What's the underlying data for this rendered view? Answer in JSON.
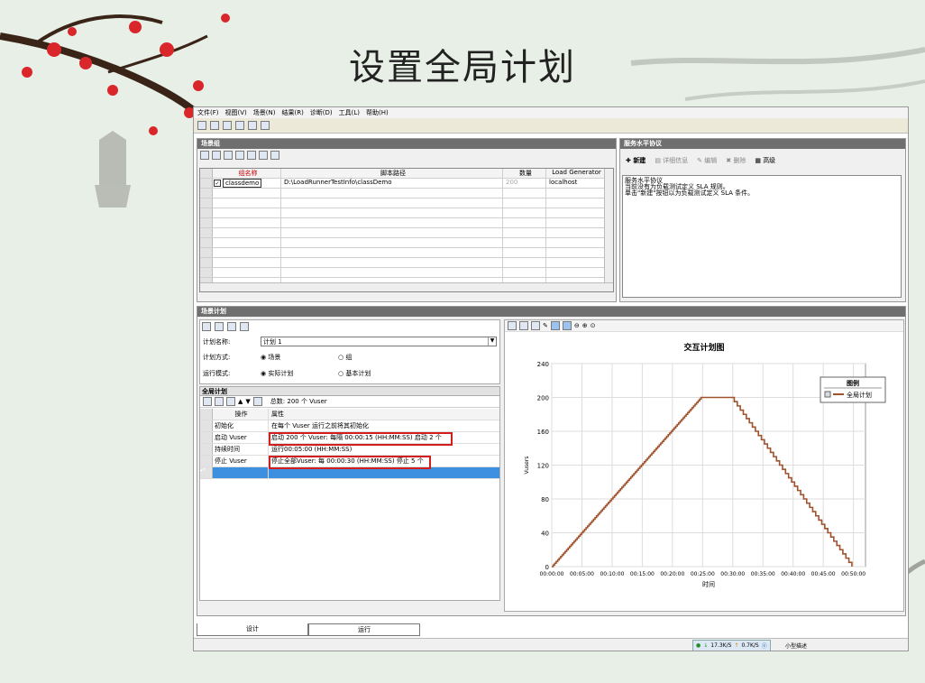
{
  "slide_title": "设置全局计划",
  "menu": [
    "文件(F)",
    "视图(V)",
    "场景(N)",
    "结果(R)",
    "诊断(D)",
    "工具(L)",
    "帮助(H)"
  ],
  "scenario_group": {
    "header": "场景组",
    "columns": [
      "组名称",
      "脚本路径",
      "数量",
      "Load Generator"
    ],
    "row": {
      "name": "classdemo",
      "path": "D:\\LoadRunnerTestInfo\\classDemo",
      "qty": "200",
      "generator": "localhost"
    }
  },
  "sla": {
    "header": "服务水平协议",
    "buttons": [
      "新建",
      "详细信息",
      "编辑",
      "删除",
      "高级"
    ],
    "lines": [
      "服务水平协议",
      "当前没有为负载测试定义 SLA 规则。",
      "单击\"新建\"按钮以为负载测试定义 SLA 条件。"
    ]
  },
  "schedule": {
    "header": "场景计划",
    "name_label": "计划名称:",
    "name_value": "计划 1",
    "mode_label": "计划方式:",
    "mode_opt1": "场景",
    "mode_opt2": "组",
    "run_label": "运行模式:",
    "run_opt1": "实际计划",
    "run_opt2": "基本计划"
  },
  "global": {
    "header": "全局计划",
    "total": "总数: 200 个 Vuser",
    "col_action": "操作",
    "col_attr": "属性",
    "rows": [
      {
        "action": "初始化",
        "attr": "在每个 Vuser 运行之前将其初始化"
      },
      {
        "action": "启动 Vuser",
        "attr": "启动 200 个 Vuser: 每隔 00:00:15 (HH:MM:SS) 启动 2 个"
      },
      {
        "action": "持续时间",
        "attr": "运行00:05:00 (HH:MM:SS)"
      },
      {
        "action": "停止 Vuser",
        "attr": "停止全部Vuser: 每 00:00:30 (HH:MM:SS) 停止 5 个"
      }
    ]
  },
  "chart_data": {
    "type": "line",
    "title": "交互计划图",
    "xlabel": "时间",
    "ylabel": "Vusers",
    "xticks": [
      "00:00:00",
      "00:05:00",
      "00:10:00",
      "00:15:00",
      "00:20:00",
      "00:25:00",
      "00:30:00",
      "00:35:00",
      "00:40:00",
      "00:45:00",
      "00:50:00"
    ],
    "yticks": [
      0,
      40,
      80,
      120,
      160,
      200,
      240
    ],
    "ylim": [
      0,
      240
    ],
    "xlim_minutes": [
      0,
      52
    ],
    "legend_title": "图例",
    "series": [
      {
        "name": "全局计划",
        "color": "#a0522d",
        "points_minutes": [
          [
            0,
            0
          ],
          [
            24.75,
            200
          ],
          [
            29.75,
            200
          ],
          [
            49.75,
            0
          ]
        ]
      }
    ]
  },
  "tabs": [
    "设计",
    "运行"
  ],
  "status": {
    "down": "17.3K/S",
    "up": "0.7K/S",
    "trail": "小型描述"
  }
}
